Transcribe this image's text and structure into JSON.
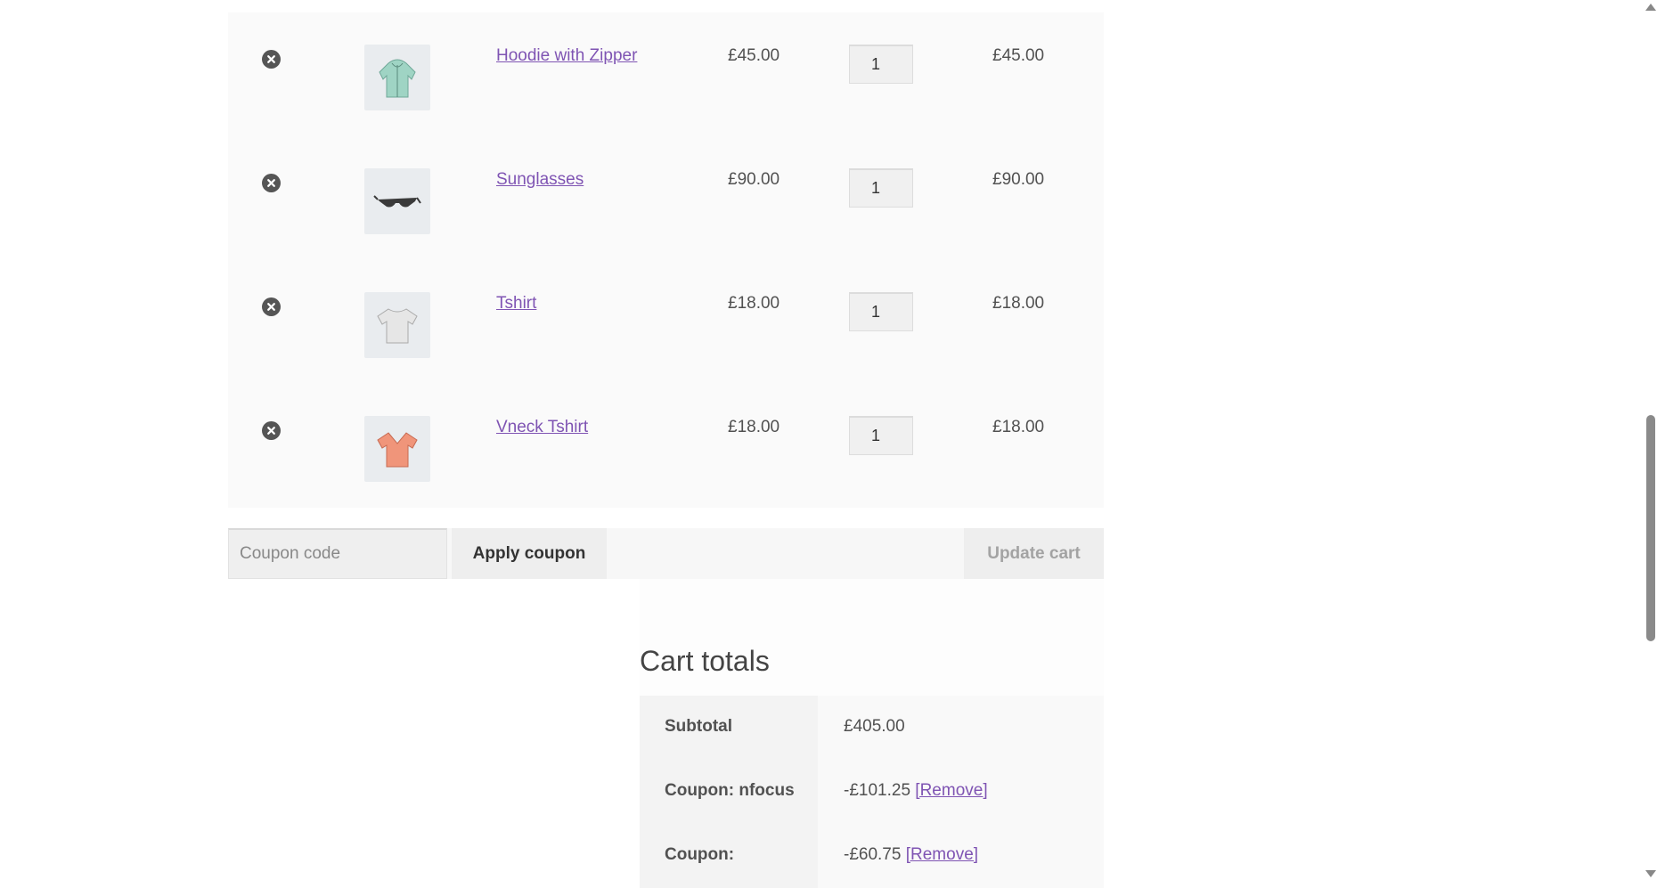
{
  "cart": {
    "items": [
      {
        "name": "Hoodie with Zipper",
        "price": "£45.00",
        "quantity": "1",
        "subtotal": "£45.00",
        "image": "hoodie-icon"
      },
      {
        "name": "Sunglasses",
        "price": "£90.00",
        "quantity": "1",
        "subtotal": "£90.00",
        "image": "sunglasses-icon"
      },
      {
        "name": "Tshirt",
        "price": "£18.00",
        "quantity": "1",
        "subtotal": "£18.00",
        "image": "tshirt-icon"
      },
      {
        "name": "Vneck Tshirt",
        "price": "£18.00",
        "quantity": "1",
        "subtotal": "£18.00",
        "image": "vneck-tshirt-icon"
      }
    ]
  },
  "actions": {
    "coupon_placeholder": "Coupon code",
    "apply_label": "Apply coupon",
    "update_label": "Update cart"
  },
  "totals": {
    "title": "Cart totals",
    "rows": [
      {
        "label": "Subtotal",
        "value": "£405.00",
        "link": ""
      },
      {
        "label": "Coupon: nfocus",
        "value": "-£101.25",
        "link": "[Remove]"
      },
      {
        "label": "Coupon:",
        "value": "-£60.75",
        "link": "[Remove]"
      }
    ]
  },
  "colors": {
    "link": "#7f54b3",
    "text": "#515151",
    "row_bg": "#fafafa"
  }
}
